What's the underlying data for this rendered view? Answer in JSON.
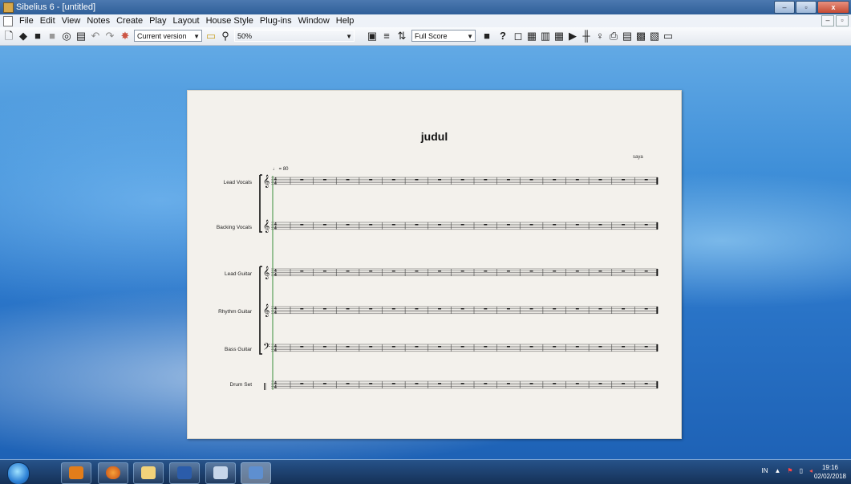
{
  "window": {
    "title": "Sibelius 6 - [untitled]",
    "minimize": "–",
    "maximize": "▫",
    "close": "x"
  },
  "menubar": {
    "items": [
      "File",
      "Edit",
      "View",
      "Notes",
      "Create",
      "Play",
      "Layout",
      "House Style",
      "Plug-ins",
      "Window",
      "Help"
    ]
  },
  "toolbar": {
    "version_combo": "Current version",
    "zoom_combo": "50%",
    "view_combo": "Full Score",
    "help_glyph": "?"
  },
  "score": {
    "title": "judul",
    "composer": "saya",
    "tempo": "♩ = 80",
    "instruments": [
      "Lead Vocals",
      "Backing Vocals",
      "Lead Guitar",
      "Rhythm Guitar",
      "Bass Guitar",
      "Drum Set"
    ],
    "clefs": [
      "treble",
      "treble",
      "treble",
      "treble-8",
      "bass",
      "percussion"
    ],
    "time_signature": "4/4",
    "bars": 16
  },
  "taskbar": {
    "apps": [
      "media-player",
      "firefox",
      "explorer",
      "word",
      "paint",
      "sibelius"
    ],
    "lang": "IN",
    "time": "19:16",
    "date": "02/02/2018"
  },
  "colors": {
    "accent": "#2f5f99",
    "paper": "#f3f1ec",
    "system_line": "#3a8f3a"
  }
}
